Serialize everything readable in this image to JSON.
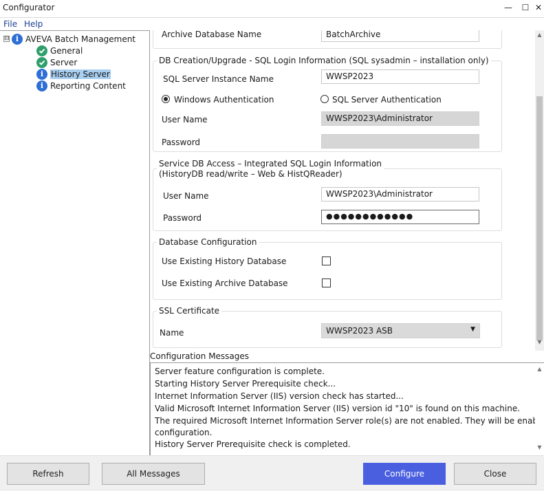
{
  "window": {
    "title": "Configurator",
    "minimize_glyph": "—",
    "maximize_glyph": "☐",
    "close_glyph": "✕"
  },
  "menu": {
    "file": "File",
    "help": "Help"
  },
  "tree": {
    "root": {
      "label": "AVEVA Batch Management",
      "icon": "info-icon",
      "expander": "⊟"
    },
    "items": [
      {
        "label": "General",
        "icon": "check-icon"
      },
      {
        "label": "Server",
        "icon": "check-icon"
      },
      {
        "label": "History Server",
        "icon": "info-icon",
        "selected": true
      },
      {
        "label": "Reporting Content",
        "icon": "info-icon"
      }
    ]
  },
  "archive": {
    "label": "Archive Database Name",
    "value": "BatchArchive"
  },
  "db_creation": {
    "title": "DB Creation/Upgrade - SQL Login Information (SQL sysadmin – installation only)",
    "instance_label": "SQL Server Instance Name",
    "instance_value": "WWSP2023",
    "windows_auth_label": "Windows Authentication",
    "sql_auth_label": "SQL Server Authentication",
    "auth_selected": "windows",
    "user_label": "User Name",
    "user_value": "WWSP2023\\Administrator",
    "password_label": "Password",
    "password_value": ""
  },
  "service_db": {
    "title_line1": "Service DB Access – Integrated SQL Login Information",
    "title_line2": "(HistoryDB read/write – Web & HistQReader)",
    "user_label": "User Name",
    "user_value": "WWSP2023\\Administrator",
    "password_label": "Password",
    "password_value": "●●●●●●●●●●●●"
  },
  "db_config": {
    "title": "Database Configuration",
    "history_label": "Use Existing History Database",
    "history_checked": false,
    "archive_label": "Use Existing Archive Database",
    "archive_checked": false
  },
  "ssl": {
    "title": "SSL Certificate",
    "name_label": "Name",
    "selected": "WWSP2023 ASB"
  },
  "messages": {
    "title": "Configuration Messages",
    "lines": [
      "Server feature configuration is complete.",
      "Starting History Server Prerequisite check...",
      "Internet Information Server (IIS) version check has started...",
      "Valid Microsoft Internet Information Server (IIS) version id \"10\" is found on this machine.",
      "The required Microsoft Internet Information Server role(s) are not enabled. They will be enabled during",
      "configuration.",
      "History Server Prerequisite check is completed."
    ]
  },
  "buttons": {
    "refresh": "Refresh",
    "all_messages": "All Messages",
    "configure": "Configure",
    "close": "Close"
  },
  "colors": {
    "accent": "#4a5fe0",
    "info": "#2e6fd6",
    "ok": "#2e9e6b",
    "selection": "#a8cef0"
  }
}
